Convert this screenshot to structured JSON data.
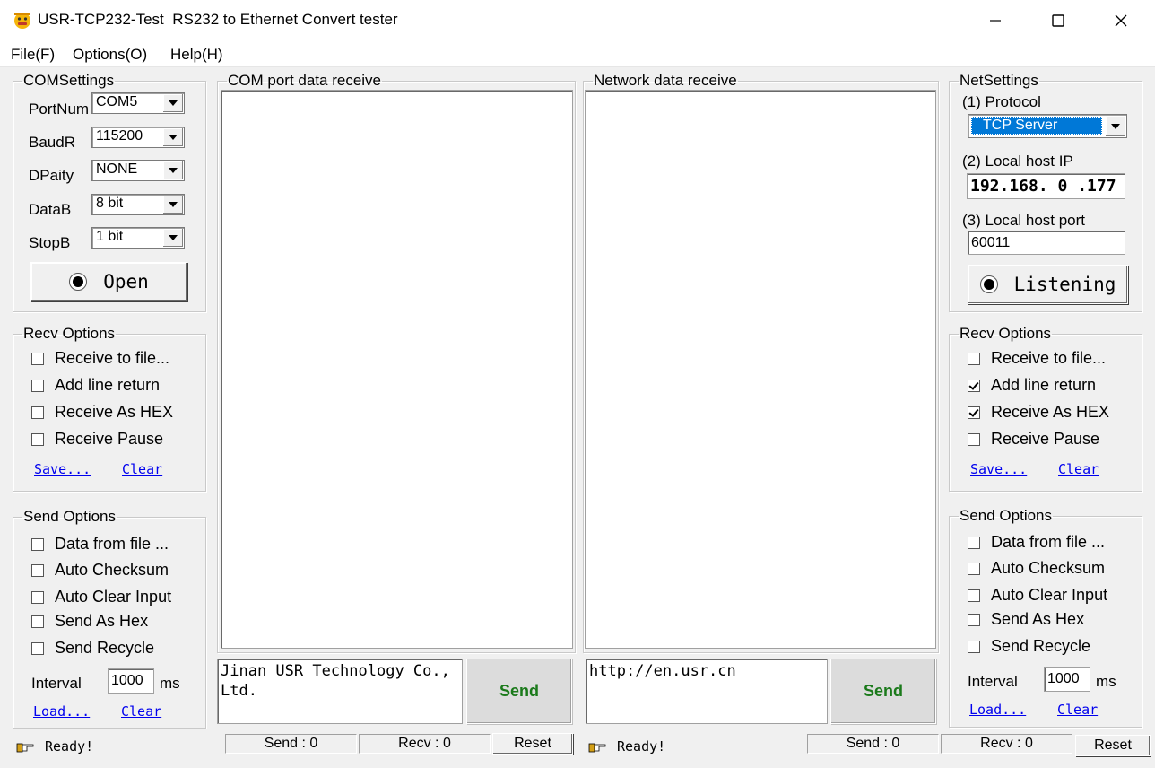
{
  "window": {
    "title": "USR-TCP232-Test  RS232 to Ethernet Convert tester",
    "icon": "app-icon",
    "controls": [
      "minimize-icon",
      "maximize-icon",
      "close-icon"
    ]
  },
  "menu": [
    "File(F)",
    "Options(O)",
    "Help(H)"
  ],
  "com_settings": {
    "legend": "COMSettings",
    "fields": [
      {
        "label": "PortNum",
        "value": "COM5"
      },
      {
        "label": "BaudR",
        "value": "115200"
      },
      {
        "label": "DPaity",
        "value": "NONE"
      },
      {
        "label": "DataB",
        "value": "8 bit"
      },
      {
        "label": "StopB",
        "value": "1 bit"
      }
    ],
    "open_button": "Open"
  },
  "left_recv": {
    "legend": "Recv Options",
    "options": [
      {
        "label": "Receive to file...",
        "checked": false
      },
      {
        "label": "Add line return",
        "checked": false
      },
      {
        "label": "Receive As HEX",
        "checked": false
      },
      {
        "label": "Receive Pause",
        "checked": false
      }
    ],
    "save": "Save...",
    "clear": "Clear"
  },
  "left_send": {
    "legend": "Send Options",
    "options": [
      {
        "label": "Data from file ...",
        "checked": false
      },
      {
        "label": "Auto Checksum",
        "checked": false
      },
      {
        "label": "Auto Clear Input",
        "checked": false
      },
      {
        "label": "Send As Hex",
        "checked": false
      },
      {
        "label": "Send Recycle",
        "checked": false
      }
    ],
    "interval_label": "Interval",
    "interval_value": "1000",
    "interval_unit": "ms",
    "load": "Load...",
    "clear": "Clear"
  },
  "com_receive": {
    "legend": "COM port data receive",
    "send_text": "Jinan USR Technology Co., Ltd.",
    "send_button": "Send"
  },
  "net_receive": {
    "legend": "Network data receive",
    "send_text": "http://en.usr.cn",
    "send_button": "Send"
  },
  "net_settings": {
    "legend": "NetSettings",
    "protocol_label": "(1) Protocol",
    "protocol_value": "TCP Server",
    "ip_label": "(2) Local host IP",
    "ip_value": "192.168. 0 .177",
    "port_label": "(3) Local host port",
    "port_value": "60011",
    "listen_button": "Listening"
  },
  "right_recv": {
    "legend": "Recv Options",
    "options": [
      {
        "label": "Receive to file...",
        "checked": false
      },
      {
        "label": "Add line return",
        "checked": true
      },
      {
        "label": "Receive As HEX",
        "checked": true
      },
      {
        "label": "Receive Pause",
        "checked": false
      }
    ],
    "save": "Save...",
    "clear": "Clear"
  },
  "right_send": {
    "legend": "Send Options",
    "options": [
      {
        "label": "Data from file ...",
        "checked": false
      },
      {
        "label": "Auto Checksum",
        "checked": false
      },
      {
        "label": "Auto Clear Input",
        "checked": false
      },
      {
        "label": "Send As Hex",
        "checked": false
      },
      {
        "label": "Send Recycle",
        "checked": false
      }
    ],
    "interval_label": "Interval",
    "interval_value": "1000",
    "interval_unit": "ms",
    "load": "Load...",
    "clear": "Clear"
  },
  "status": {
    "left_ready": "Ready!",
    "left_send": "Send : 0",
    "left_recv": "Recv : 0",
    "left_reset": "Reset",
    "right_ready": "Ready!",
    "right_send": "Send : 0",
    "right_recv": "Recv : 0",
    "right_reset": "Reset"
  },
  "colors": {
    "accent_selection": "#0078d7",
    "send_green": "#1b7a1b",
    "link_blue": "#0000ee"
  }
}
